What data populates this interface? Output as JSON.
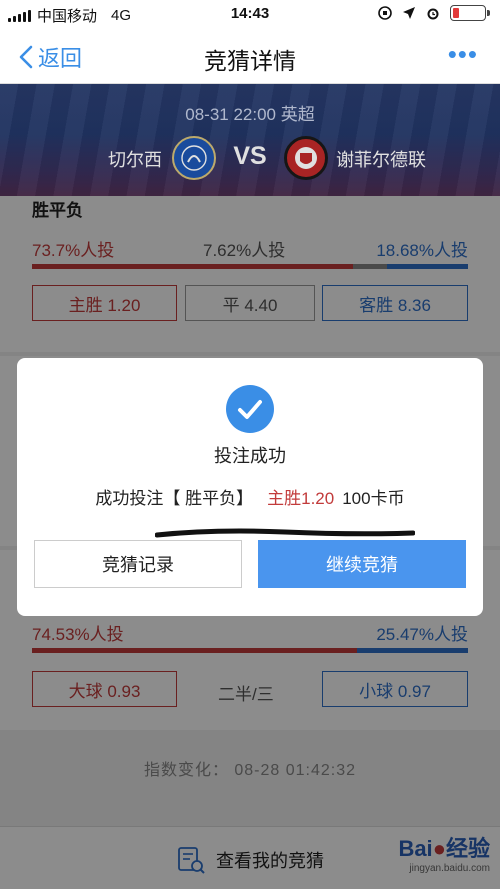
{
  "status_bar": {
    "carrier": "中国移动",
    "network": "4G",
    "time": "14:43"
  },
  "nav": {
    "back_label": "返回",
    "title": "竞猜详情",
    "more_label": "•••"
  },
  "match": {
    "datetime_league": "08-31 22:00 英超",
    "home_team": "切尔西",
    "vs": "VS",
    "away_team": "谢菲尔德联"
  },
  "win_draw_loss": {
    "title": "胜平负",
    "home_pct": "73.7%人投",
    "draw_pct": "7.62%人投",
    "away_pct": "18.68%人投",
    "home_share": 73.7,
    "draw_share": 7.62,
    "away_share": 18.68,
    "home_btn": "主胜 1.20",
    "draw_btn": "平 4.40",
    "away_btn": "客胜 8.36"
  },
  "over_under": {
    "over_pct": "74.53%人投",
    "under_pct": "25.47%人投",
    "over_share": 74.53,
    "under_share": 25.47,
    "over_btn": "大球 0.93",
    "line": "二半/三",
    "under_btn": "小球 0.97"
  },
  "index_change": "指数变化： 08-28 01:42:32",
  "bottom": {
    "my_bets_label": "查看我的竞猜",
    "watermark_logo": "Bai",
    "watermark_logo2": "经验",
    "watermark_url": "jingyan.baidu.com"
  },
  "modal": {
    "title": "投注成功",
    "message_prefix": "成功投注【 胜平负】",
    "pick": "主胜1.20",
    "amount": "100卡币",
    "records_button": "竞猜记录",
    "continue_button": "继续竞猜"
  },
  "colors": {
    "accent_blue": "#3a8ee6",
    "home_red": "#c23b3b",
    "away_blue": "#2f6fc8"
  }
}
